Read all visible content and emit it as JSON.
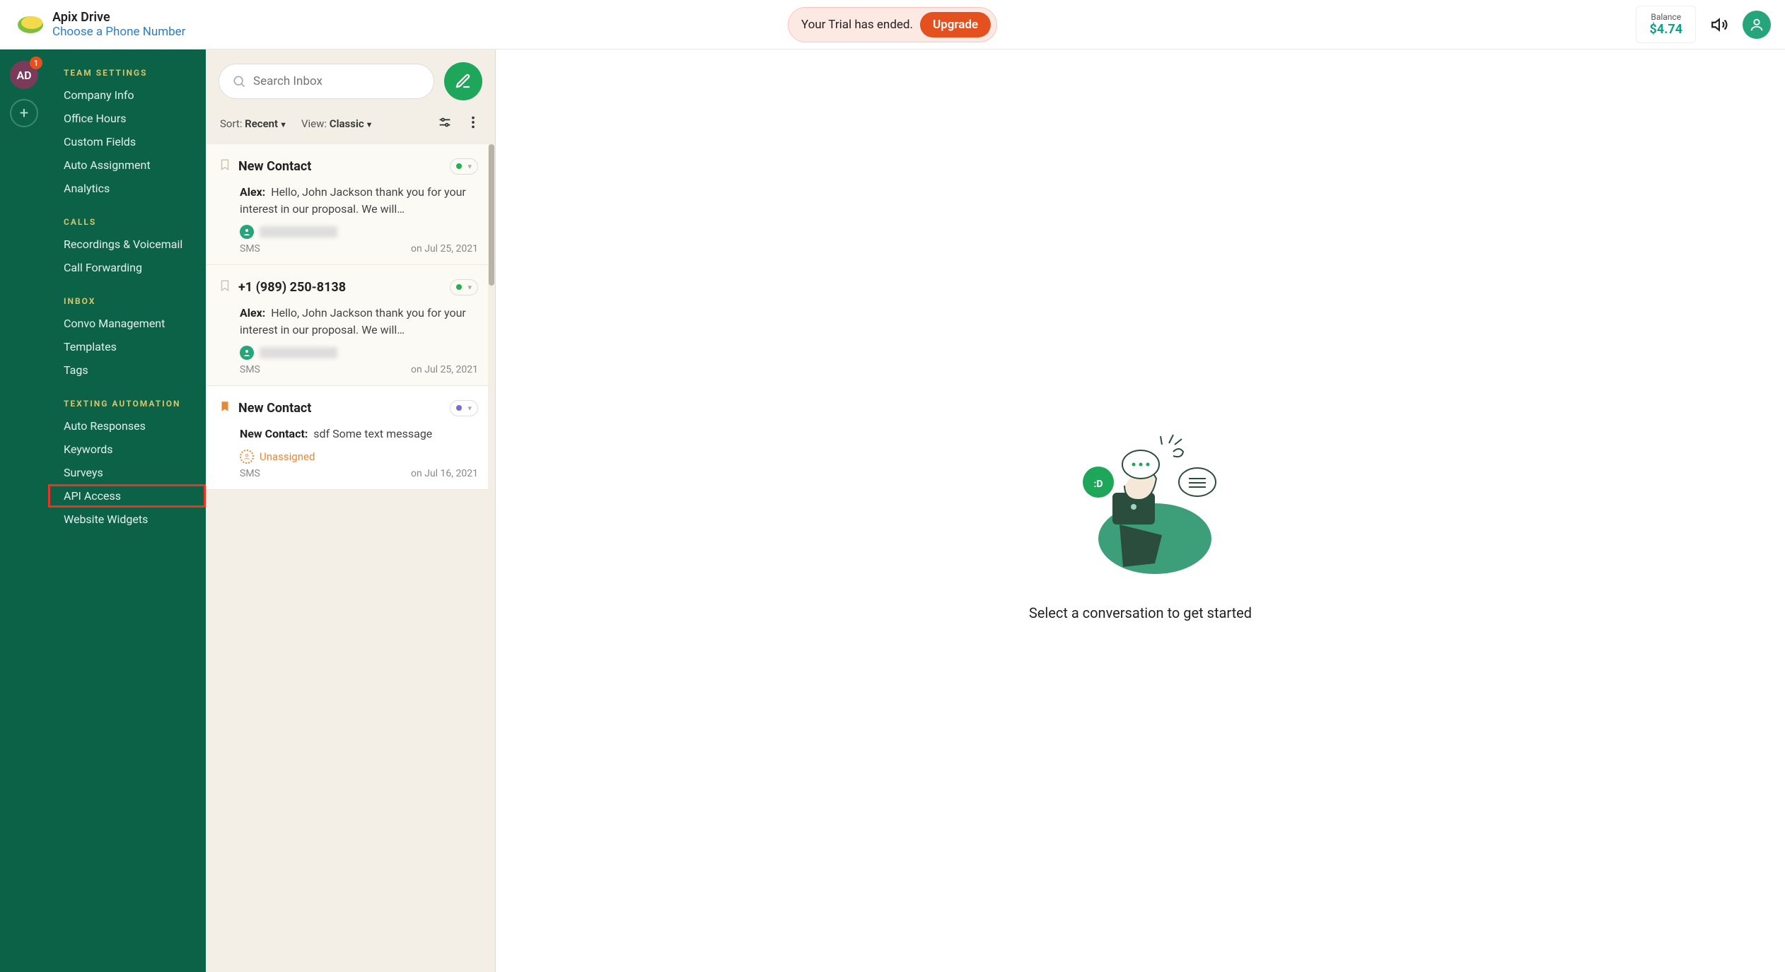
{
  "header": {
    "app_title": "Apix Drive",
    "phone_link": "Choose a Phone Number",
    "trial_text": "Your Trial has ended.",
    "upgrade_label": "Upgrade",
    "balance_label": "Balance",
    "balance_amount": "$4.74"
  },
  "rail": {
    "avatar_initials": "AD",
    "badge_count": "1"
  },
  "sidebar": {
    "sections": [
      {
        "heading": "TEAM SETTINGS",
        "items": [
          "Company Info",
          "Office Hours",
          "Custom Fields",
          "Auto Assignment",
          "Analytics"
        ]
      },
      {
        "heading": "CALLS",
        "items": [
          "Recordings & Voicemail",
          "Call Forwarding"
        ]
      },
      {
        "heading": "INBOX",
        "items": [
          "Convo Management",
          "Templates",
          "Tags"
        ]
      },
      {
        "heading": "TEXTING AUTOMATION",
        "items": [
          "Auto Responses",
          "Keywords",
          "Surveys",
          "API Access",
          "Website Widgets"
        ]
      }
    ]
  },
  "inbox": {
    "search_placeholder": "Search Inbox",
    "sort_label": "Sort: ",
    "sort_value": "Recent",
    "view_label": "View: ",
    "view_value": "Classic",
    "conversations": [
      {
        "title": "New Contact",
        "sender": "Alex:",
        "snippet": "Hello, John Jackson thank you for your interest in our proposal. We will…",
        "assigned": true,
        "channel": "SMS",
        "date": "on Jul 25, 2021",
        "status": "green",
        "bookmarked": false
      },
      {
        "title": "+1 (989) 250-8138",
        "sender": "Alex:",
        "snippet": "Hello, John Jackson thank you for your interest in our proposal. We will…",
        "assigned": true,
        "channel": "SMS",
        "date": "on Jul 25, 2021",
        "status": "green",
        "bookmarked": false
      },
      {
        "title": "New Contact",
        "sender": "New Contact:",
        "snippet": "sdf Some text message",
        "assigned": false,
        "unassigned_label": "Unassigned",
        "channel": "SMS",
        "date": "on Jul 16, 2021",
        "status": "purple",
        "bookmarked": true
      }
    ]
  },
  "main": {
    "empty_text": "Select a conversation to get started"
  }
}
